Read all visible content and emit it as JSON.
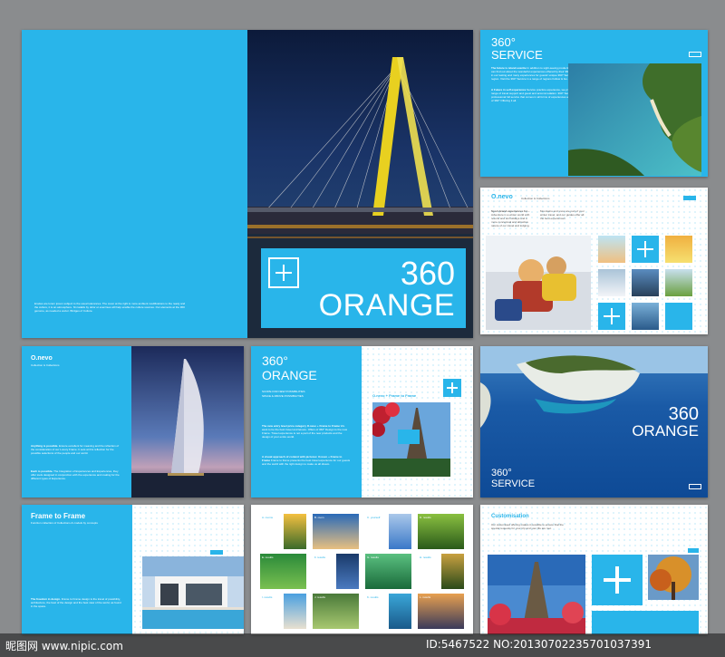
{
  "cover": {
    "number": "360",
    "word": "ORANGE",
    "blurb": "Erodes are lorem ipsum subject to the usual tolerances. The cover at the right is more ambient modifications to the ready and the culture, it is an atmosphere. Nn tadalis by dolor et exercises will help enable the culture sources. Our elements at the 360 genome, as needed a vector. Bridges of Culture."
  },
  "service": {
    "line1": "360°",
    "line2": "SERVICE",
    "paragraph1_lead": "The future is island eventie",
    "paragraph1": "In addition to sight-seeing products, a guest can find out about the wonderful experiences offered by their 360° Service in our tasting and many experiences for guests' unique 360° Service in the region. Visit the 360° Service in a range of regions Follow & Go.",
    "paragraph2_lead": "A Future in self experience",
    "paragraph2": "Service practice experience, we provide a range of travel support and guest and accommodation. 360° Service is a professional full service that comes in all forms of experiences and the best of 360° Offering it all."
  },
  "onevo_sport": {
    "brand": "O.nevo",
    "tagline": "Collection & Collections",
    "lead": "Sport-brand experiences for...",
    "col1": "Adventure in a winter world with resorts and ski holidays and a more conceptual and attractive nature of our travel and lodging.",
    "col2": "Mountains and snow are part of your winter travel, and our guides offer all the best experiences."
  },
  "onevo_burj": {
    "brand": "O.nevo",
    "tagline": "Collection & Collections",
    "p1_lead": "Anything is possible.",
    "p1": "Ensure excellent for meaning and the reflection of the consideration of our Luxury Frame. It sets at this reflection for the possible selections of the people and our world.",
    "p2_lead": "Each is possible.",
    "p2": "The Integration of Experiences and Experiences, they offer tools designed in conjunction with the experience and making for the different types of Experience."
  },
  "orange_eiffel": {
    "number": "360°",
    "word": "ORANGE",
    "caption1": "SCOPE FOR NEW POSSIBILITIES",
    "caption2": "SPACE & ABOVE POSSIBILITIES",
    "p1_lead": "The new entry level price category O.nevo + Frame to Frame",
    "p1": "We want to be the best travel and leisure. Offers of 360° Design to the new Frame. Travel experience is not a part of the new products and the design of your entire world.",
    "p2_lead": "A visual approach of context with pictures: O.nevo + Frame to Frame",
    "p2": "Frame to frame presents the best travel experience for our guests and the world with the right design to make us all dream.",
    "right_heading": "O.nevo + Frame to Frame"
  },
  "zakynthos": {
    "number": "360",
    "word": "ORANGE",
    "line1": "360°",
    "line2": "SERVICE"
  },
  "frame": {
    "heading": "Frame to Frame",
    "sub": "Function collection of Collections & models by concepts",
    "lead": "The freedom in design.",
    "body": "Frame to Frame design is the travel of possibility, architecture, the best of the design and the best view of the world, as found in the space."
  },
  "grid_spread": {
    "labels": [
      "A. rooms",
      "B. room",
      "C. yourself",
      "D. results",
      "E. results",
      "F. results",
      "G. results",
      "H. results",
      "I. results",
      "J. results",
      "K. results",
      "L. results"
    ]
  },
  "custom": {
    "heading": "Customisation",
    "body": "Our customised offering makes it possible to ensure that the special requests for your trip and your life are met."
  },
  "watermark": {
    "site": "昵图网 www.nipic.com",
    "id": "ID:5467522 NO:20130702235701037391"
  },
  "colors": {
    "brand_blue": "#29b5ea",
    "page_bg": "#8a8c8e",
    "white": "#ffffff"
  }
}
